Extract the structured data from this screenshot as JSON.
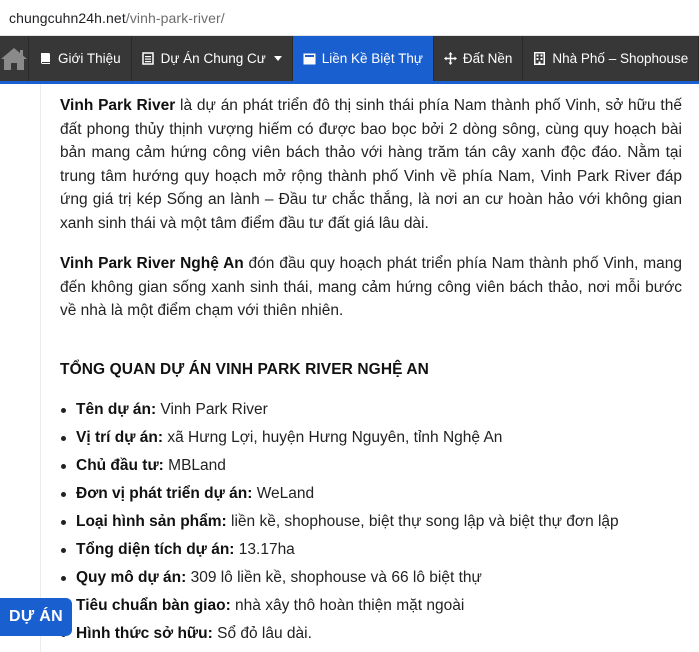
{
  "browser": {
    "url_host": "chungcuhn24h.net",
    "url_path": "/vinh-park-river/"
  },
  "nav": {
    "items": [
      {
        "label": "Giới Thiệu",
        "icon": "book-icon"
      },
      {
        "label": "Dự Án Chung Cư",
        "icon": "list-icon",
        "has_dropdown": true
      },
      {
        "label": "Liền Kề Biệt Thự",
        "icon": "card-icon",
        "active": true
      },
      {
        "label": "Đất Nền",
        "icon": "move-icon"
      },
      {
        "label": "Nhà Phố – Shophouse",
        "icon": "building-icon"
      }
    ],
    "accent_color": "#1a5fcf",
    "bar_color": "#373737"
  },
  "article": {
    "p1_strong": "Vinh Park River",
    "p1_text": " là dự án phát triển đô thị sinh thái phía Nam thành phố Vinh, sở hữu thế đất phong thủy thịnh vượng hiếm có được bao bọc bởi 2 dòng sông, cùng quy hoạch bài bản mang cảm hứng công viên bách thảo với hàng trăm tán cây xanh độc đáo. Nằm tại trung tâm hướng quy hoạch mở rộng thành phố Vinh về phía Nam, Vinh Park River đáp ứng giá trị kép Sống an lành – Đầu tư chắc thắng, là nơi an cư hoàn hảo với không gian xanh sinh thái và một tâm điểm đầu tư đất giá lâu dài.",
    "p2_strong": "Vinh Park River Nghệ An",
    "p2_text": " đón đầu quy hoạch phát triển phía Nam thành phố Vinh, mang đến không gian sống xanh sinh thái, mang cảm hứng công viên bách thảo, nơi mỗi bước về nhà là một điểm chạm với thiên nhiên.",
    "section_title": "TỔNG QUAN DỰ ÁN VINH PARK RIVER NGHỆ AN",
    "facts": [
      {
        "key": "Tên dự án:",
        "value": " Vinh Park River"
      },
      {
        "key": "Vị trí dự án:",
        "value": " xã Hưng Lợi, huyện Hưng Nguyên, tỉnh Nghệ An"
      },
      {
        "key": "Chủ đầu tư:",
        "value": " MBLand"
      },
      {
        "key": "Đơn vị phát triển dự án:",
        "value": " WeLand"
      },
      {
        "key": "Loại hình sản phẩm:",
        "value": " liền kề, shophouse, biệt thự song lập và biệt thự đơn lập"
      },
      {
        "key": "Tổng diện tích dự án:",
        "value": " 13.17ha"
      },
      {
        "key": "Quy mô dự án:",
        "value": " 309 lô liền kề, shophouse và 66 lô biệt thự"
      },
      {
        "key": "Tiêu chuẩn bàn giao:",
        "value": " nhà xây thô hoàn thiện mặt ngoài"
      },
      {
        "key": "Hình thức sở hữu:",
        "value": " Sổ đỏ lâu dài."
      }
    ]
  },
  "floating_button": {
    "label": "DỰ ÁN"
  }
}
